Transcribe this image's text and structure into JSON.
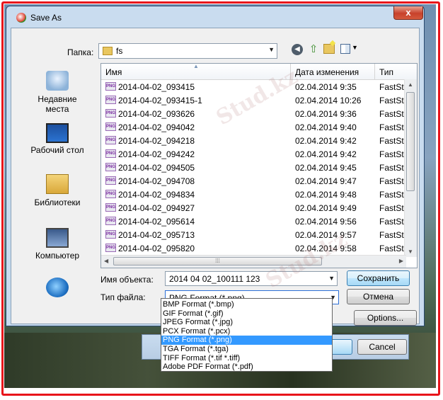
{
  "window": {
    "title": "Save As",
    "close_label": "x"
  },
  "toolbar": {
    "folder_label": "Папка:",
    "folder_value": "fs"
  },
  "places": [
    {
      "label_1": "Недавние",
      "label_2": "места",
      "icon": "recent-places-icon"
    },
    {
      "label_1": "Рабочий стол",
      "label_2": "",
      "icon": "desktop-icon"
    },
    {
      "label_1": "Библиотеки",
      "label_2": "",
      "icon": "libraries-icon"
    },
    {
      "label_1": "Компьютер",
      "label_2": "",
      "icon": "computer-icon"
    },
    {
      "label_1": "",
      "label_2": "",
      "icon": "network-icon"
    }
  ],
  "list": {
    "columns": {
      "name": "Имя",
      "date": "Дата изменения",
      "type": "Тип"
    },
    "file_badge": "PNG",
    "rows": [
      {
        "name": "2014-04-02_093415",
        "date": "02.04.2014 9:35",
        "type": "FastStone"
      },
      {
        "name": "2014-04-02_093415-1",
        "date": "02.04.2014 10:26",
        "type": "FastStone"
      },
      {
        "name": "2014-04-02_093626",
        "date": "02.04.2014 9:36",
        "type": "FastStone"
      },
      {
        "name": "2014-04-02_094042",
        "date": "02.04.2014 9:40",
        "type": "FastStone"
      },
      {
        "name": "2014-04-02_094218",
        "date": "02.04.2014 9:42",
        "type": "FastStone"
      },
      {
        "name": "2014-04-02_094242",
        "date": "02.04.2014 9:42",
        "type": "FastStone"
      },
      {
        "name": "2014-04-02_094505",
        "date": "02.04.2014 9:45",
        "type": "FastStone"
      },
      {
        "name": "2014-04-02_094708",
        "date": "02.04.2014 9:47",
        "type": "FastStone"
      },
      {
        "name": "2014-04-02_094834",
        "date": "02.04.2014 9:48",
        "type": "FastStone"
      },
      {
        "name": "2014-04-02_094927",
        "date": "02.04.2014 9:49",
        "type": "FastStone"
      },
      {
        "name": "2014-04-02_095614",
        "date": "02.04.2014 9:56",
        "type": "FastStone"
      },
      {
        "name": "2014-04-02_095713",
        "date": "02.04.2014 9:57",
        "type": "FastStone"
      },
      {
        "name": "2014-04-02_095820",
        "date": "02.04.2014 9:58",
        "type": "FastStone"
      }
    ]
  },
  "form": {
    "filename_label": "Имя объекта:",
    "filename_value": "2014 04 02_100111 123",
    "filetype_label": "Тип файла:",
    "filetype_value": "PNG Format (*.png)"
  },
  "buttons": {
    "save": "Сохранить",
    "cancel": "Отмена",
    "options": "Options...",
    "back_cancel": "Cancel"
  },
  "filetype_options": [
    "BMP Format (*.bmp)",
    "GIF Format (*.gif)",
    "JPEG Format (*.jpg)",
    "PCX Format (*.pcx)",
    "PNG Format (*.png)",
    "TGA Format (*.tga)",
    "TIFF Format (*.tif *.tiff)",
    "Adobe PDF Format (*.pdf)"
  ],
  "selected_option_index": 4,
  "watermark": "Stud.kz",
  "colors": {
    "frame": "#e8141b",
    "selection": "#3399ff"
  }
}
